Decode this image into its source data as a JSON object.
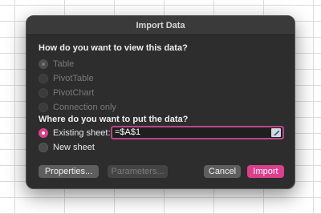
{
  "dialog": {
    "title": "Import Data",
    "view_question": "How do you want to view this data?",
    "view_options": [
      {
        "label": "Table",
        "state": "disabled-checked"
      },
      {
        "label": "PivotTable",
        "state": "disabled"
      },
      {
        "label": "PivotChart",
        "state": "disabled"
      },
      {
        "label": "Connection only",
        "state": "disabled"
      }
    ],
    "place_question": "Where do you want to put the data?",
    "place_options": [
      {
        "label": "Existing sheet:",
        "state": "checked"
      },
      {
        "label": "New sheet",
        "state": "unchecked"
      }
    ],
    "reference_value": "=$A$1",
    "buttons": {
      "properties": "Properties...",
      "parameters": "Parameters...",
      "cancel": "Cancel",
      "import": "Import"
    }
  },
  "colors": {
    "accent": "#dc3f8c",
    "dialog_bg": "#2d2d2d",
    "field_border": "#b9478a"
  }
}
